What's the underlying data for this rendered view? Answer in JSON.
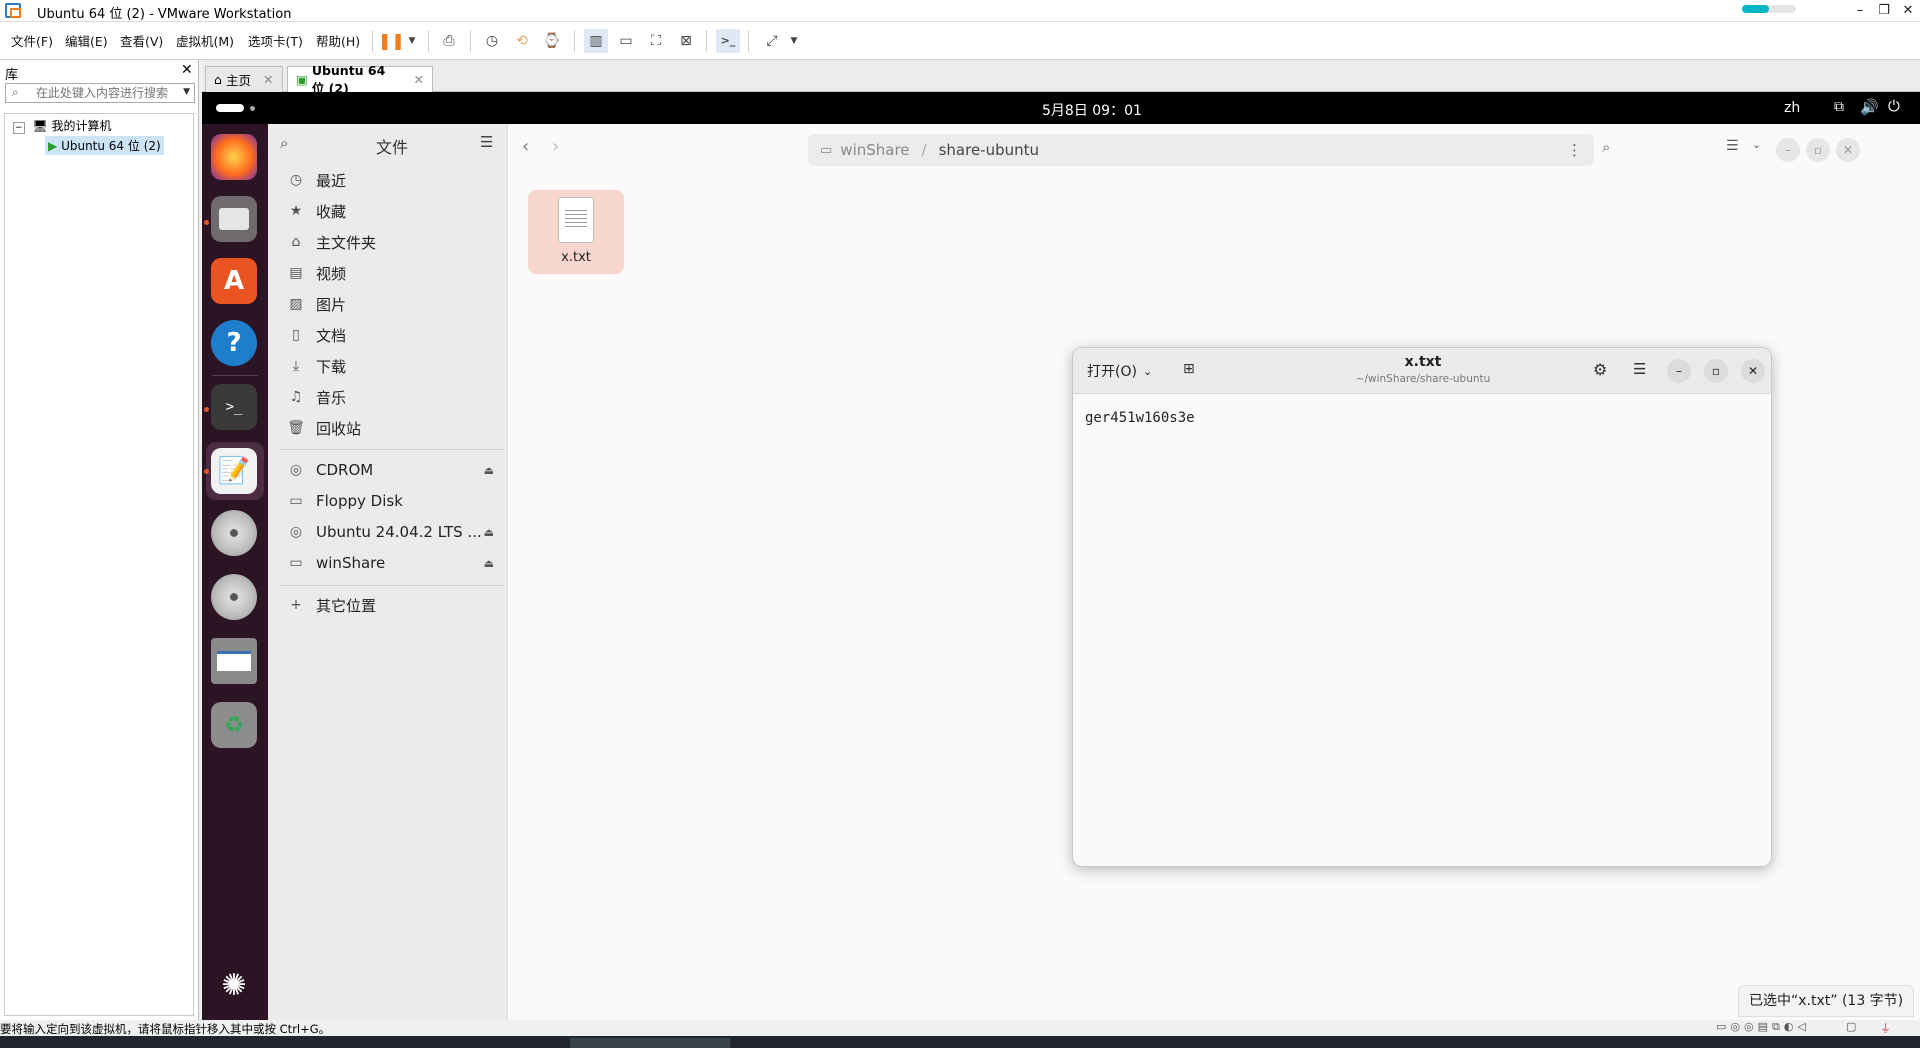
{
  "window": {
    "title": "Ubuntu 64 位 (2) - VMware Workstation",
    "minimize": "–",
    "maximize": "❐",
    "close": "✕",
    "progress_fraction": 0.5
  },
  "menu": [
    "文件(F)",
    "编辑(E)",
    "查看(V)",
    "虚拟机(M)",
    "选项卡(T)",
    "帮助(H)"
  ],
  "library": {
    "title": "库",
    "close": "✕",
    "search_placeholder": "在此处键入内容进行搜索",
    "tree": {
      "root": "我的计算机",
      "vm": "Ubuntu 64 位 (2)"
    }
  },
  "tabs": {
    "home": "主页",
    "vm": "Ubuntu 64 位 (2)",
    "close": "✕"
  },
  "gnome": {
    "clock": "5月8日 09：01",
    "input_method": "zh"
  },
  "nautilus": {
    "sidebar_title": "文件",
    "places": [
      {
        "label": "最近",
        "icon": "clock-icon"
      },
      {
        "label": "收藏",
        "icon": "star-icon"
      },
      {
        "label": "主文件夹",
        "icon": "home-icon"
      },
      {
        "label": "视频",
        "icon": "video-icon"
      },
      {
        "label": "图片",
        "icon": "picture-icon"
      },
      {
        "label": "文档",
        "icon": "document-icon"
      },
      {
        "label": "下载",
        "icon": "download-icon"
      },
      {
        "label": "音乐",
        "icon": "music-icon"
      },
      {
        "label": "回收站",
        "icon": "trash-icon"
      }
    ],
    "devices": [
      {
        "label": "CDROM",
        "eject": true
      },
      {
        "label": "Floppy Disk",
        "eject": false
      },
      {
        "label": "Ubuntu 24.04.2 LTS ...",
        "eject": true
      },
      {
        "label": "winShare",
        "eject": true
      }
    ],
    "other_locations": "其它位置",
    "path": [
      "winShare",
      "share-ubuntu"
    ],
    "path_separator": "/",
    "files": [
      {
        "name": "x.txt"
      }
    ],
    "status": "已选中“x.txt” (13 字节)"
  },
  "editor": {
    "open_button": "打开(O)",
    "title": "x.txt",
    "subtitle": "~/winShare/share-ubuntu",
    "content": "ger451w160s3e"
  },
  "statusbar": {
    "message": "要将输入定向到该虚拟机，请将鼠标指针移入其中或按 Ctrl+G。"
  },
  "colors": {
    "ubuntu_orange": "#e95420",
    "dock_bg": "#2b1424",
    "selection_bg": "#f6d6cd"
  }
}
